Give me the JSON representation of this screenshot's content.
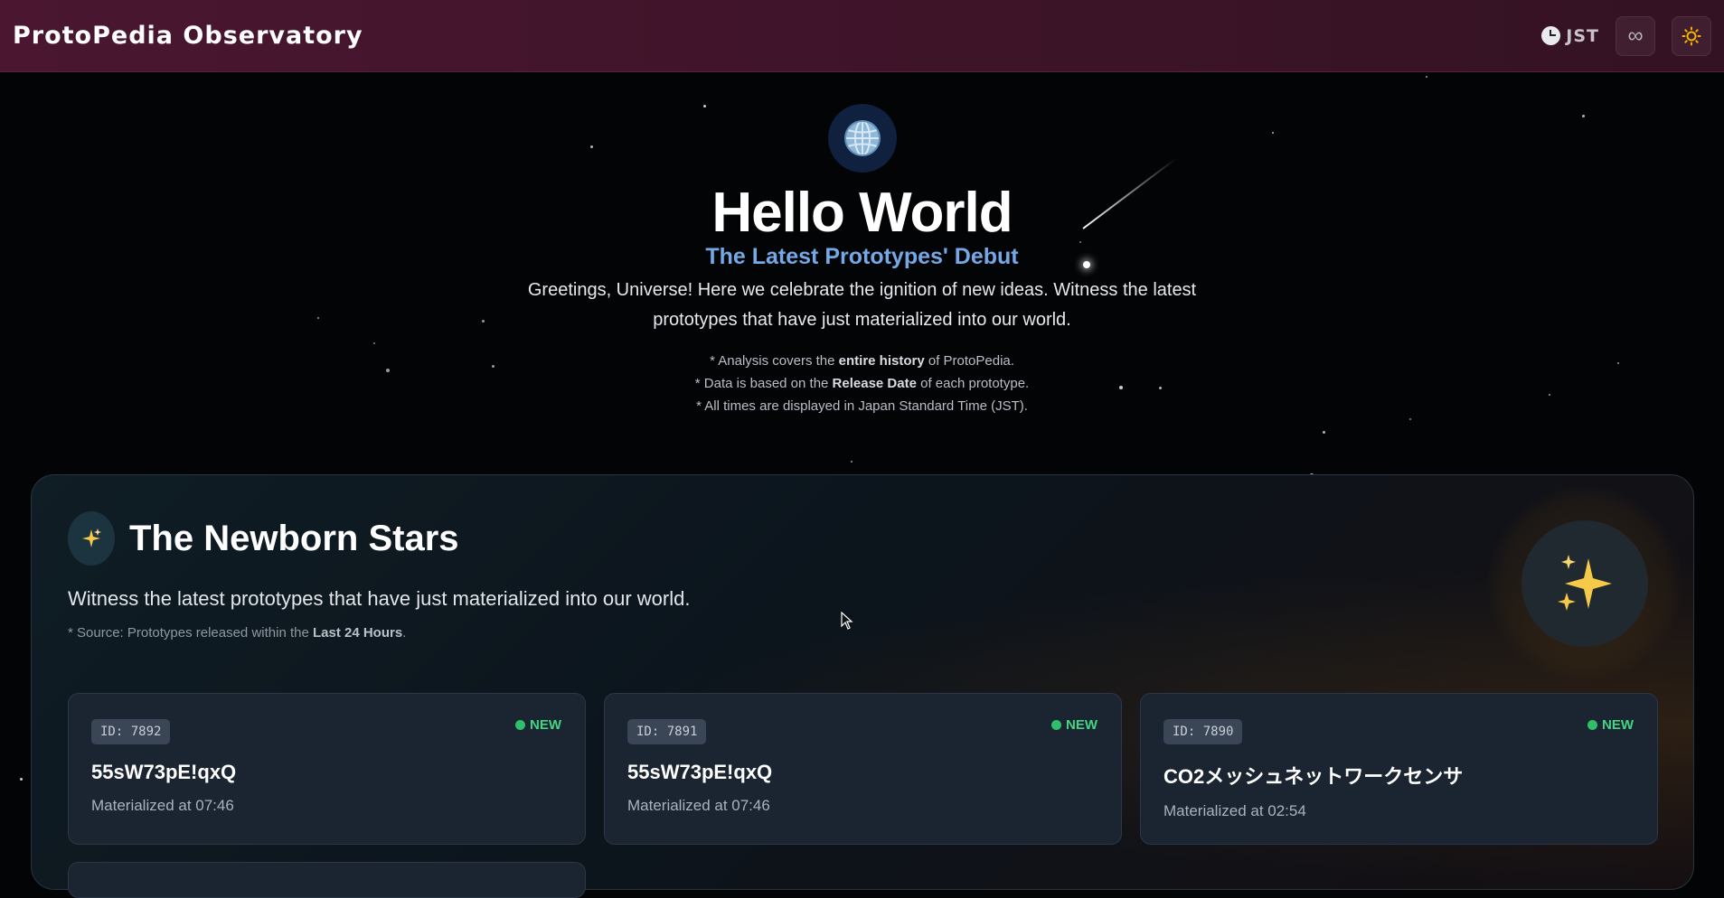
{
  "header": {
    "title": "ProtoPedia Observatory",
    "timezone_label": "JST",
    "timezone_icon": "clock-icon",
    "infinity_icon": "infinity-icon",
    "theme_icon": "sun-icon",
    "accent_color": "#4a1630"
  },
  "hero": {
    "icon": "globe-icon",
    "title": "Hello World",
    "subtitle": "The Latest Prototypes' Debut",
    "lead": "Greetings, Universe! Here we celebrate the ignition of new ideas. Witness the latest prototypes that have just materialized into our world.",
    "notes": [
      {
        "prefix": "* Analysis covers the ",
        "bold": "entire history",
        "suffix": " of ProtoPedia."
      },
      {
        "prefix": "* Data is based on the ",
        "bold": "Release Date",
        "suffix": " of each prototype."
      },
      {
        "prefix": "* All times are displayed in Japan Standard Time (JST).",
        "bold": "",
        "suffix": ""
      }
    ]
  },
  "section": {
    "icon": "sparkles-icon",
    "title": "The Newborn Stars",
    "description": "Witness the latest prototypes that have just materialized into our world.",
    "source_prefix": "* Source: Prototypes released within the ",
    "source_bold": "Last 24 Hours",
    "source_suffix": ".",
    "cards": [
      {
        "id": "ID: 7892",
        "badge": "NEW",
        "title": "55sW73pE!qxQ",
        "time": "Materialized at 07:46"
      },
      {
        "id": "ID: 7891",
        "badge": "NEW",
        "title": "55sW73pE!qxQ",
        "time": "Materialized at 07:46"
      },
      {
        "id": "ID: 7890",
        "badge": "NEW",
        "title": "CO2メッシュネットワークセンサ",
        "time": "Materialized at 02:54"
      }
    ],
    "badge_color": "#45d483"
  }
}
